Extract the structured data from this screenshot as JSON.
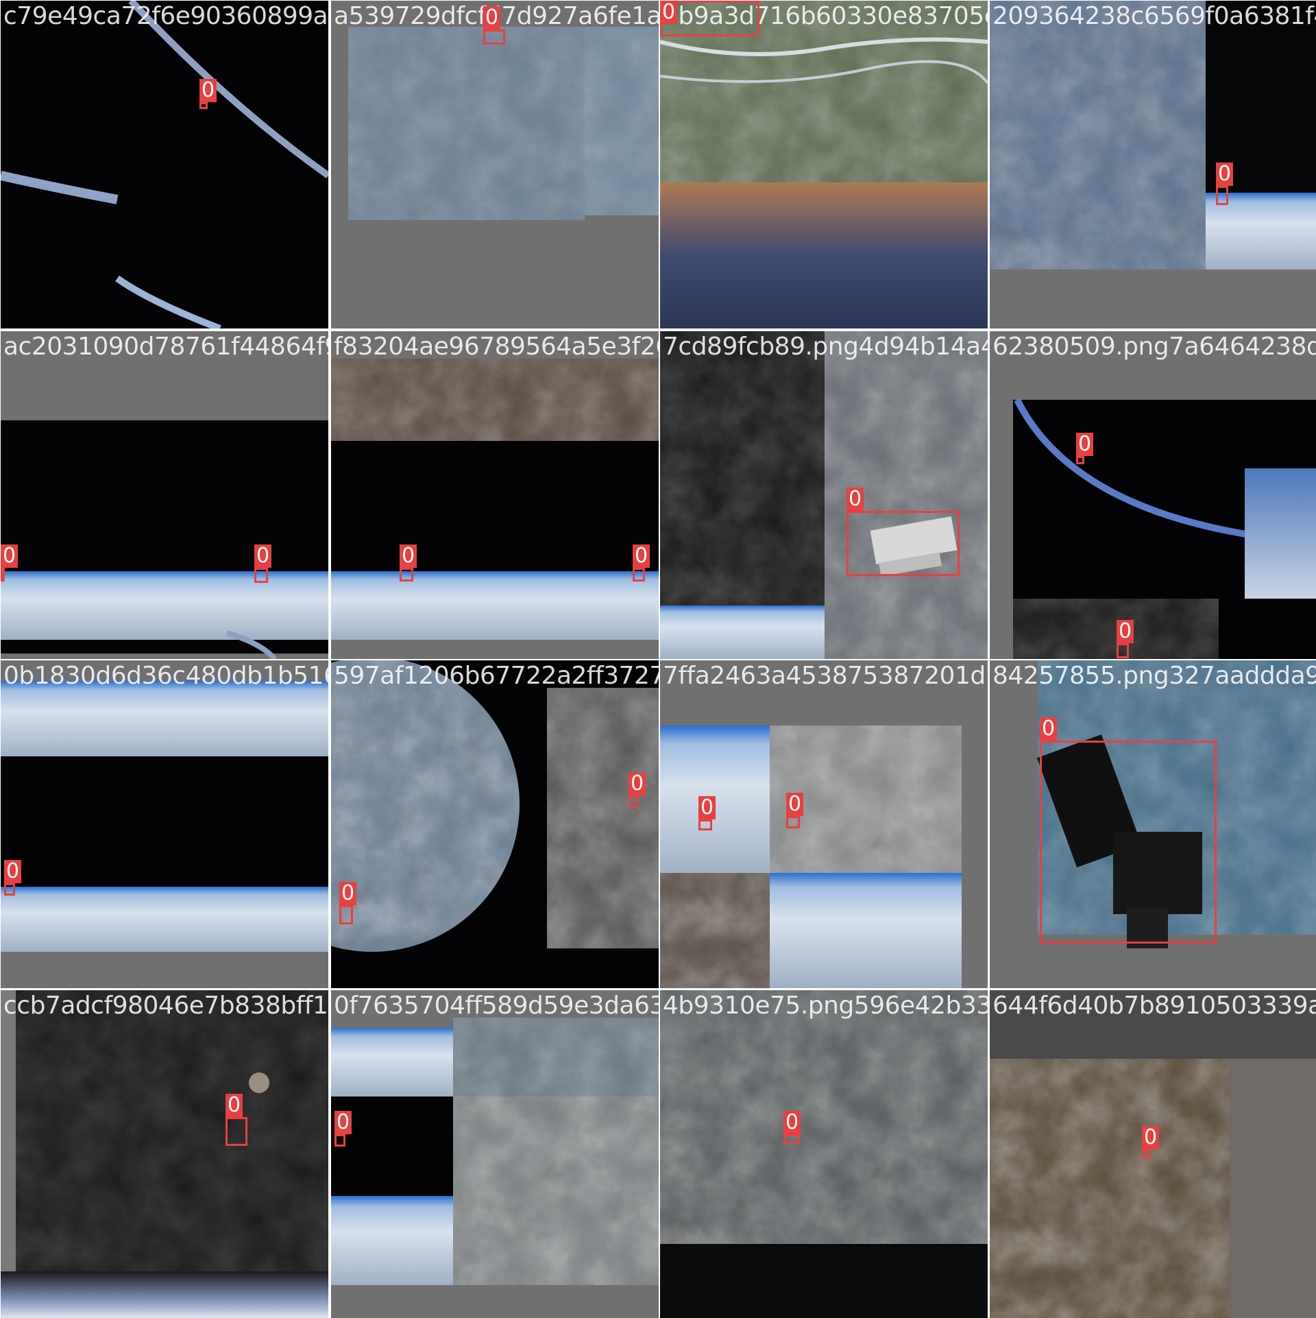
{
  "tiles": [
    {
      "id": "t00",
      "filename": "c79e49ca72f6e90360899a0e",
      "filename2": "a5397f29dfcfd7d927a6fe1a2c49a3d71d6",
      "scene": "limb-arcs",
      "label": "0"
    },
    {
      "id": "t01",
      "filename": "a539729dfcfd7d927a6fe1a2c4093d716b",
      "scene": "gray-cloud-panel",
      "label": "0"
    },
    {
      "id": "t02",
      "filename": "2b9a3d716b60330e83705c5209364238c",
      "scene": "rivers-mountains",
      "label": "0"
    },
    {
      "id": "t03",
      "filename": "209364238c6569f0a6381f46",
      "scene": "mountains-horizon",
      "label": "0"
    },
    {
      "id": "t10",
      "filename": "ac2031090d78761f44864f9ff83204ae96789564a5e3f268",
      "scene": "dark-horizon",
      "label": "0"
    },
    {
      "id": "t11",
      "filename": "f83204ae96789564a5e3f268edc87fcb89.png",
      "scene": "dark-horizon-mountains",
      "label": "0"
    },
    {
      "id": "t12",
      "filename": "7cd89fcb89.png4d94b14a420a62380509.png",
      "scene": "station-over-land",
      "label": "0"
    },
    {
      "id": "t13",
      "filename": "62380509.png7a6464238dac",
      "scene": "blue-limb",
      "label": "0"
    },
    {
      "id": "t20",
      "filename": "0b1830d6d36c480db1b5164f592af1206b67",
      "scene": "horizon-bands",
      "label": "0"
    },
    {
      "id": "t21",
      "filename": "597af1206b67722a2ff3727c98fa2463.png",
      "scene": "globe-clouds",
      "label": "0"
    },
    {
      "id": "t22",
      "filename": "7ffa2463a453875387201d78425785564",
      "scene": "clouds-mosaic",
      "label": "0"
    },
    {
      "id": "t23",
      "filename": "84257855.png327aaddda9f",
      "scene": "station-closeup",
      "label": "0"
    },
    {
      "id": "t30",
      "filename": "ccb7adcf98046e7b838bff19e0f76357.png",
      "scene": "moon-dark",
      "label": "0"
    },
    {
      "id": "t31",
      "filename": "0f7635704ff589d59e3da6394b9e26e596",
      "scene": "clouds-horizon",
      "label": "0"
    },
    {
      "id": "t32",
      "filename": "4b9310e75.png596e42b33ea3644f6d40b7",
      "scene": "gray-clouds",
      "label": "0"
    },
    {
      "id": "t33",
      "filename": "644f6d40b7b8910503339a",
      "scene": "volcano",
      "label": "0"
    }
  ],
  "colors": {
    "box": "#e84040",
    "divider": "#ffffff",
    "pad": "#7a7a7a"
  }
}
